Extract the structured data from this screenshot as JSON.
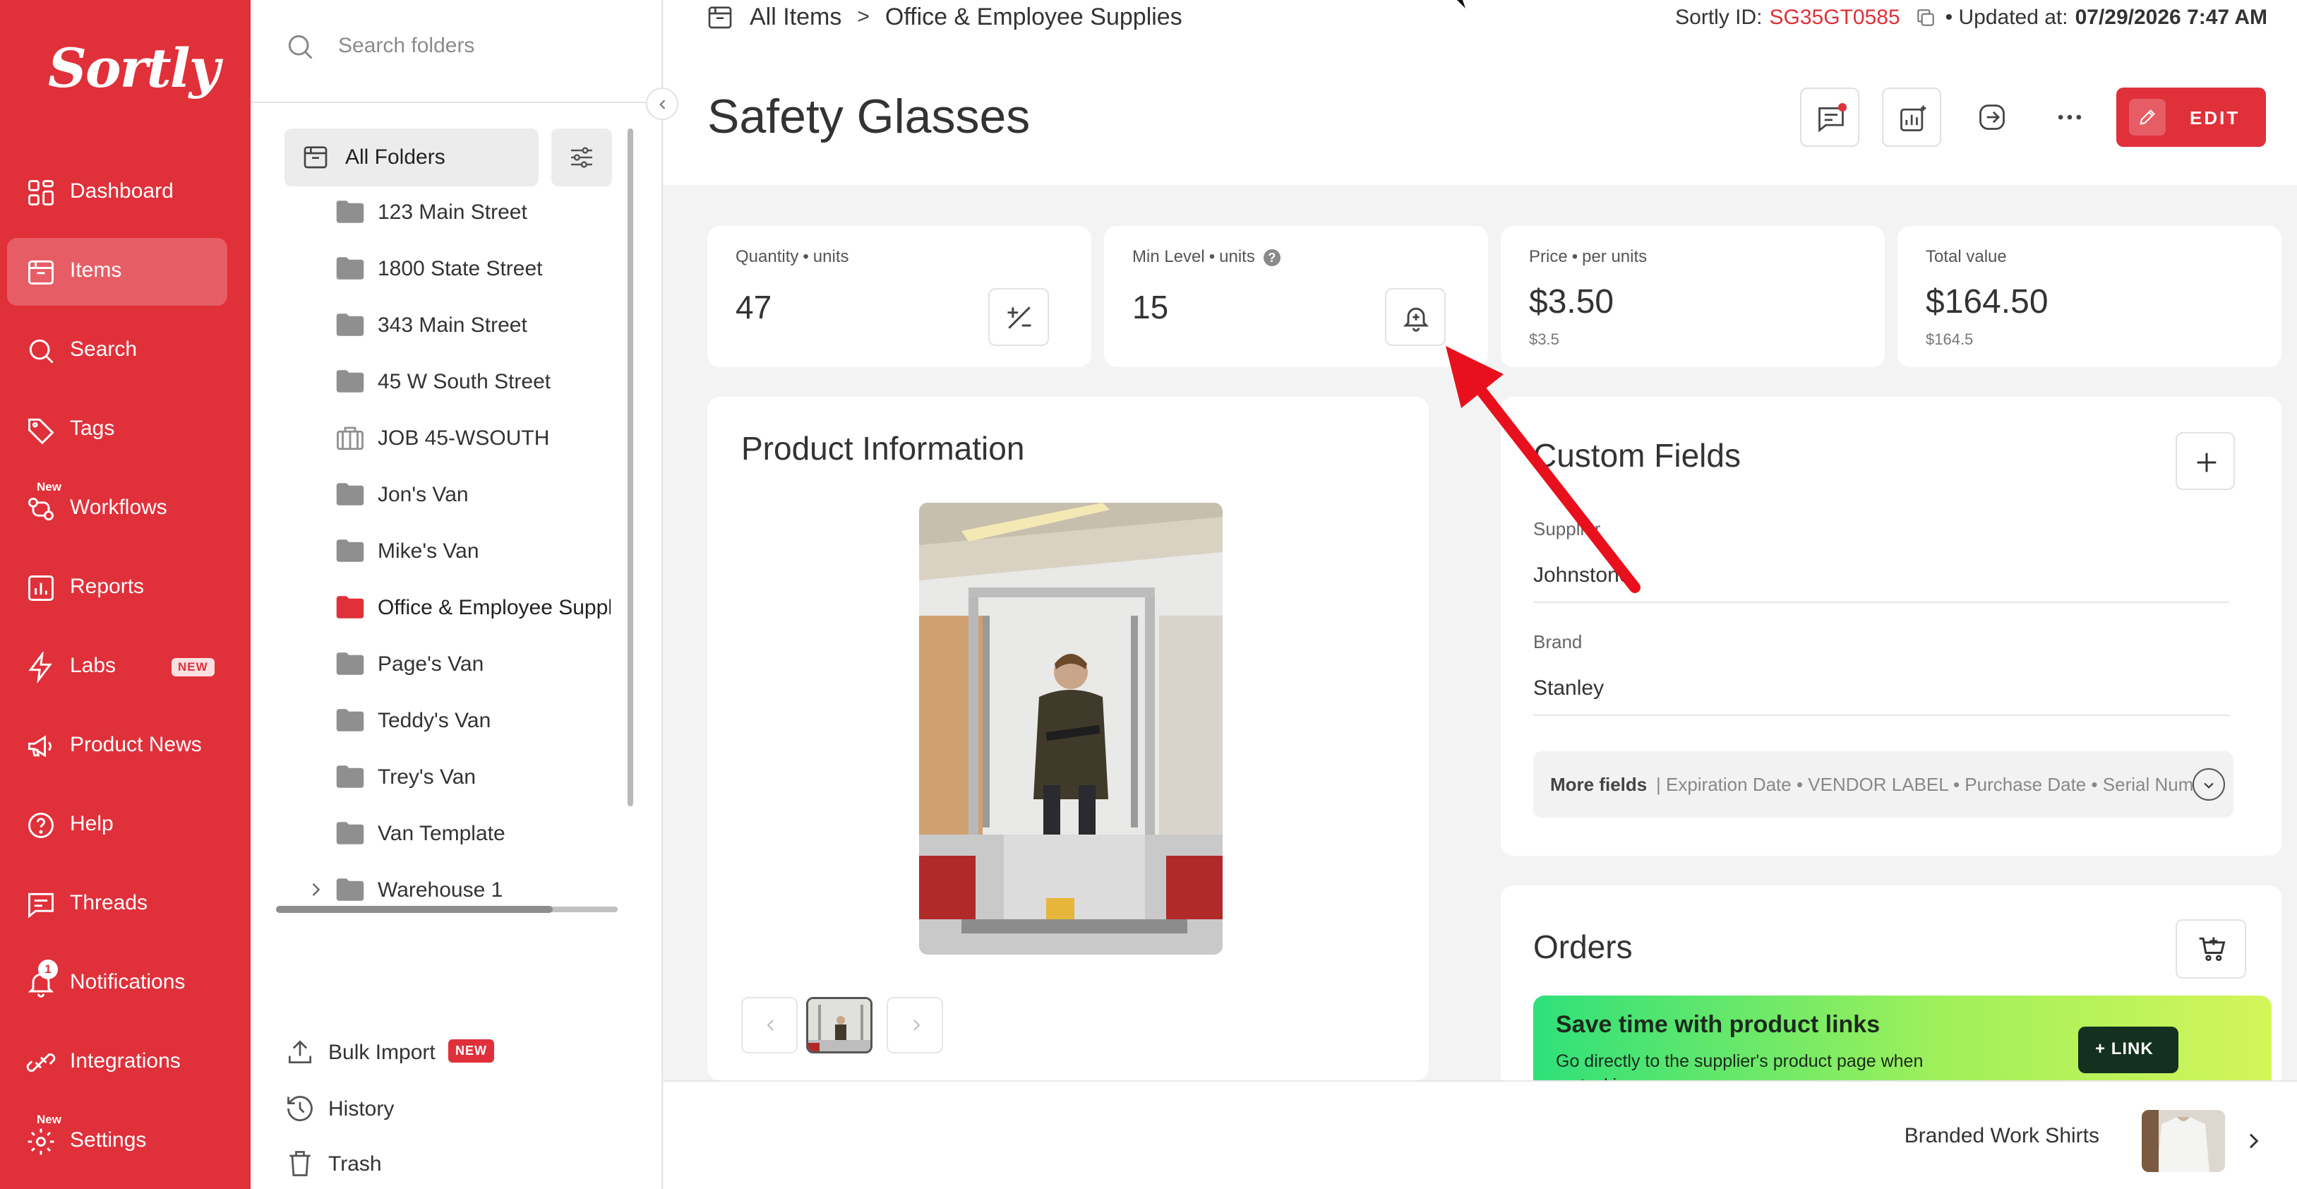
{
  "nav": {
    "logo": "Sortly",
    "items": [
      {
        "label": "Dashboard"
      },
      {
        "label": "Items"
      },
      {
        "label": "Search"
      },
      {
        "label": "Tags"
      },
      {
        "label": "Workflows",
        "badge": "New"
      },
      {
        "label": "Reports"
      },
      {
        "label": "Labs",
        "pill": "NEW"
      },
      {
        "label": "Product News"
      },
      {
        "label": "Help"
      },
      {
        "label": "Threads"
      },
      {
        "label": "Notifications",
        "count": "1"
      },
      {
        "label": "Integrations"
      },
      {
        "label": "Settings",
        "badge": "New"
      }
    ],
    "active": "Items"
  },
  "folders": {
    "search_placeholder": "Search folders",
    "all_label": "All Folders",
    "list": [
      {
        "label": "123 Main Street"
      },
      {
        "label": "1800 State Street"
      },
      {
        "label": "343 Main Street"
      },
      {
        "label": "45 W South Street"
      },
      {
        "label": "JOB 45-WSOUTH",
        "icon": "job-icon"
      },
      {
        "label": "Jon's Van"
      },
      {
        "label": "Mike's Van"
      },
      {
        "label": "Office & Employee Supplies",
        "active": true
      },
      {
        "label": "Page's Van"
      },
      {
        "label": "Teddy's Van"
      },
      {
        "label": "Trey's Van"
      },
      {
        "label": "Van Template"
      },
      {
        "label": "Warehouse 1",
        "expandable": true
      }
    ],
    "bottom": {
      "bulk_import": "Bulk Import",
      "bulk_import_badge": "NEW",
      "history": "History",
      "trash": "Trash"
    }
  },
  "breadcrumb": {
    "root": "All Items",
    "separator": ">",
    "current": "Office & Employee Supplies"
  },
  "meta": {
    "sortly_id_label": "Sortly ID:",
    "sortly_id": "SG35GT0585",
    "updated_label": "• Updated at:",
    "updated_value": "07/29/2026 7:47 AM"
  },
  "item": {
    "title": "Safety Glasses",
    "edit_label": "EDIT"
  },
  "stats": {
    "quantity": {
      "label": "Quantity",
      "unit": "units",
      "value": "47"
    },
    "min_level": {
      "label": "Min Level",
      "unit": "units",
      "value": "15"
    },
    "price": {
      "label": "Price",
      "unit": "per units",
      "value": "$3.50",
      "sub": "$3.5"
    },
    "total": {
      "label": "Total value",
      "value": "$164.50",
      "sub": "$164.5"
    }
  },
  "product_info": {
    "title": "Product Information"
  },
  "custom_fields": {
    "title": "Custom Fields",
    "fields": [
      {
        "label": "Supplier",
        "value": "Johnstone"
      },
      {
        "label": "Brand",
        "value": "Stanley"
      }
    ],
    "more_label": "More fields",
    "more_list": "| Expiration Date • VENDOR LABEL • Purchase Date • Serial Number"
  },
  "orders": {
    "title": "Orders",
    "promo_title": "Save time with product links",
    "promo_desc": "Go directly to the supplier's product page when restocking.",
    "promo_button": "LINK"
  },
  "next_item": {
    "label": "Branded Work Shirts"
  },
  "colors": {
    "brand": "#e0303a",
    "annotation": "#e8101c"
  }
}
